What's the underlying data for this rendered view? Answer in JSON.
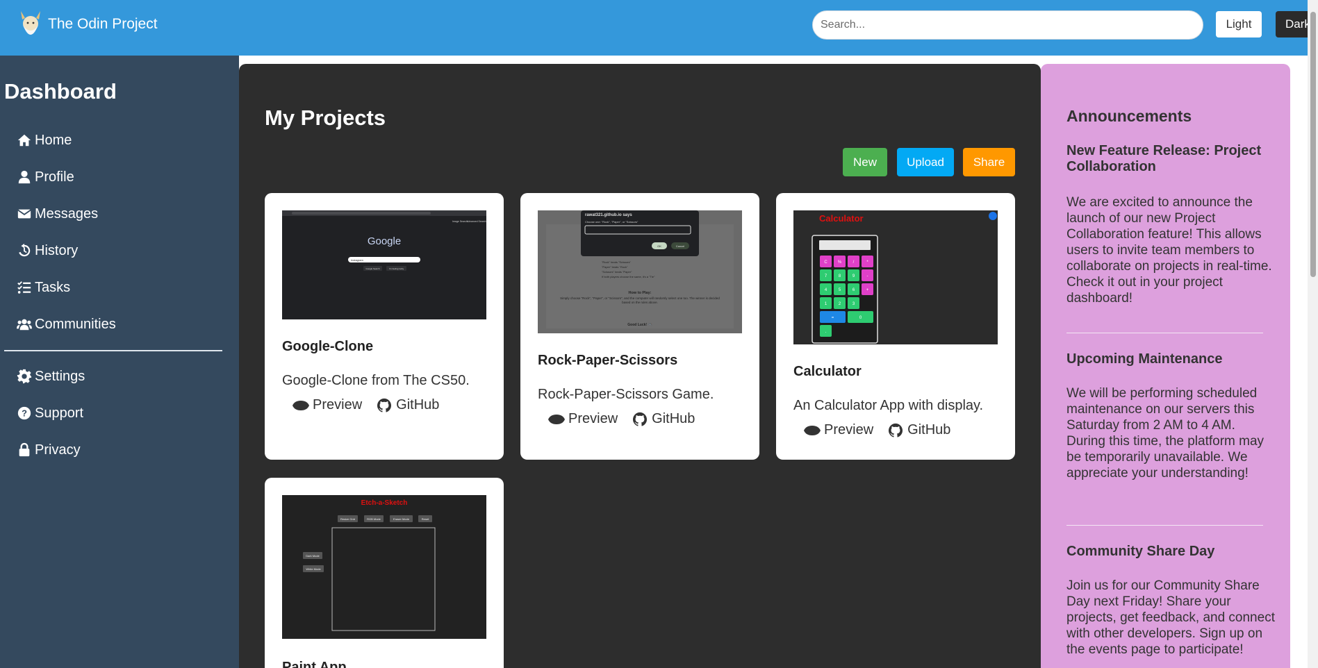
{
  "header": {
    "brand": "The Odin Project",
    "search_placeholder": "Search...",
    "light_label": "Light",
    "dark_label": "Dark"
  },
  "sidebar": {
    "title": "Dashboard",
    "items": [
      {
        "label": "Home",
        "icon": "home-icon"
      },
      {
        "label": "Profile",
        "icon": "user-icon"
      },
      {
        "label": "Messages",
        "icon": "envelope-icon"
      },
      {
        "label": "History",
        "icon": "history-icon"
      },
      {
        "label": "Tasks",
        "icon": "tasks-icon"
      },
      {
        "label": "Communities",
        "icon": "users-icon"
      }
    ],
    "bottom_items": [
      {
        "label": "Settings",
        "icon": "gear-icon"
      },
      {
        "label": "Support",
        "icon": "question-circle-icon"
      },
      {
        "label": "Privacy",
        "icon": "lock-icon"
      }
    ]
  },
  "main": {
    "title": "My Projects",
    "actions": {
      "new": "New",
      "upload": "Upload",
      "share": "Share"
    },
    "action_colors": {
      "new": "#4caf50",
      "upload": "#03a9f4",
      "share": "#ff9800"
    },
    "preview_label": "Preview",
    "github_label": "GitHub",
    "projects": [
      {
        "title": "Google-Clone",
        "description": "Google-Clone from The CS50.",
        "thumb": {
          "logo": "Google",
          "search_value": "Instagram",
          "buttons": [
            "Google Search",
            "I'm feeling lucky"
          ],
          "top_links": [
            "Image Search",
            "Advanced Search"
          ]
        }
      },
      {
        "title": "Rock-Paper-Scissors",
        "description": "Rock-Paper-Scissors Game.",
        "thumb": {
          "dialog_title": "rawat321.github.io says",
          "dialog_prompt": "Choose one: \"Rock\", \"Paper\", or \"Scissors\"",
          "ok": "OK",
          "cancel": "Cancel",
          "rules": [
            "\"Rock\" beats \"Scissors\"",
            "\"Paper\" beats \"Rock\"",
            "\"Scissors\" beats \"Paper\"",
            "If both players choose the same, it's a \"Tie\""
          ],
          "how_title": "How to Play:",
          "how_text": "Simply choose \"Rock\", \"Paper\", or \"Scissors\", and the computer will randomly select one too. The winner is decided based on the rules above.",
          "good_luck": "Good Luck! 🎮"
        }
      },
      {
        "title": "Calculator",
        "description": "An Calculator App with display.",
        "thumb": {
          "title": "Calculator",
          "keys": [
            "C",
            "%",
            "/",
            "*",
            "7",
            "8",
            "9",
            "-",
            "4",
            "5",
            "6",
            "+",
            "1",
            "2",
            "3",
            "=",
            "0",
            "."
          ]
        }
      },
      {
        "title": "Paint App",
        "description": "",
        "thumb": {
          "title": "Etch-a-Sketch",
          "buttons": [
            "Resize Grid",
            "RGB Mode",
            "Eraser Mode",
            "Reset"
          ],
          "side_buttons": [
            "Dark Mode",
            "White Mode"
          ]
        }
      }
    ]
  },
  "announcements": {
    "title": "Announcements",
    "items": [
      {
        "heading": "New Feature Release: Project Collaboration",
        "text": "We are excited to announce the launch of our new Project Collaboration feature! This allows users to invite team members to collaborate on projects in real-time. Check it out in your project dashboard!"
      },
      {
        "heading": "Upcoming Maintenance",
        "text": "We will be performing scheduled maintenance on our servers this Saturday from 2 AM to 4 AM. During this time, the platform may be temporarily unavailable. We appreciate your understanding!"
      },
      {
        "heading": "Community Share Day",
        "text": "Join us for our Community Share Day next Friday! Share your projects, get feedback, and connect with other developers. Sign up on the events page to participate!"
      }
    ]
  },
  "colors": {
    "header": "#3498db",
    "sidebar": "#34495e",
    "main": "#2d2d2d",
    "announcements": "#dda0dd"
  }
}
